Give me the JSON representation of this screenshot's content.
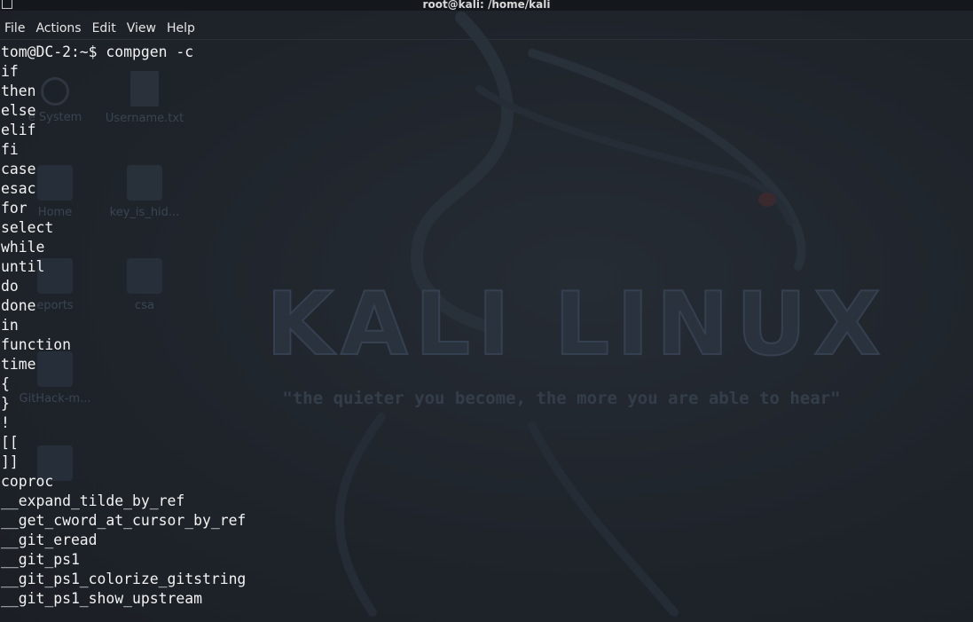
{
  "window": {
    "title": "root@kali: /home/kali"
  },
  "menu": {
    "items": [
      {
        "label": "File"
      },
      {
        "label": "Actions"
      },
      {
        "label": "Edit"
      },
      {
        "label": "View"
      },
      {
        "label": "Help"
      }
    ]
  },
  "desktop": {
    "logo_text": "KALI LINUX",
    "slogan": "\"the quieter you become, the more you are able to hear\"",
    "icons": [
      {
        "caption": "e System",
        "icon": "drive-icon"
      },
      {
        "caption": "Username.txt",
        "icon": "text-file-icon"
      },
      {
        "caption": "Home",
        "icon": "home-folder-icon"
      },
      {
        "caption": "key_is_hid...",
        "icon": "document-icon"
      },
      {
        "caption": "eports",
        "icon": "folder-icon"
      },
      {
        "caption": "csa",
        "icon": "locked-folder-icon"
      },
      {
        "caption": "GitHack-m...",
        "icon": "folder-icon"
      }
    ]
  },
  "terminal": {
    "lines": [
      "tom@DC-2:~$ compgen -c",
      "if",
      "then",
      "else",
      "elif",
      "fi",
      "case",
      "esac",
      "for",
      "select",
      "while",
      "until",
      "do",
      "done",
      "in",
      "function",
      "time",
      "{",
      "}",
      "!",
      "[[",
      "]]",
      "coproc",
      "__expand_tilde_by_ref",
      "__get_cword_at_cursor_by_ref",
      "__git_eread",
      "__git_ps1",
      "__git_ps1_colorize_gitstring",
      "__git_ps1_show_upstream"
    ]
  },
  "colors": {
    "background": "#1f242b",
    "text": "#f2f2f2",
    "panel": "#14171b"
  }
}
